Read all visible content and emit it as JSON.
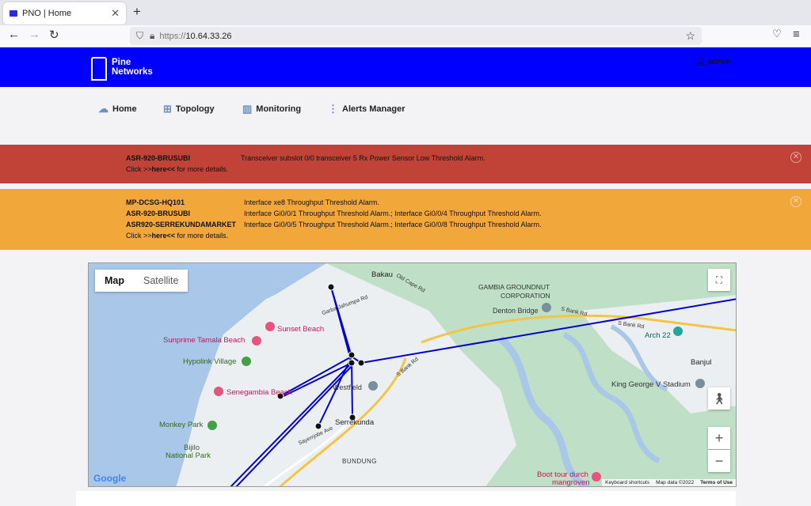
{
  "browser": {
    "tab_title": "PNO | Home",
    "url_protocol": "https://",
    "url_host": "10.64.33.26"
  },
  "header": {
    "logo_line1": "Pine",
    "logo_line2": "Networks",
    "user": "admin"
  },
  "menu": [
    {
      "label": "Home"
    },
    {
      "label": "Topology"
    },
    {
      "label": "Monitoring"
    },
    {
      "label": "Alerts Manager"
    }
  ],
  "alerts": {
    "red": {
      "device": "ASR-920-BRUSUBI",
      "message": "Transceiver subslot 0/0 transceiver 5 Rx Power Sensor Low Threshold Alarm.",
      "click_prefix": "Click >>",
      "click_link": "here<<",
      "click_suffix": " for more details."
    },
    "orange": {
      "rows": [
        {
          "device": "MP-DCSG-HQ101",
          "message": "Interface xe8 Throughput Threshold Alarm."
        },
        {
          "device": "ASR-920-BRUSUBI",
          "message": "Interface Gi0/0/1 Throughput Threshold Alarm.; Interface Gi0/0/4 Throughput Threshold Alarm."
        },
        {
          "device": "ASR920-SERREKUNDAMARKET",
          "message": "Interface Gi0/0/5 Throughput Threshold Alarm.; Interface Gi0/0/8 Throughput Threshold Alarm."
        }
      ],
      "click_prefix": "Click >>",
      "click_link": "here<<",
      "click_suffix": " for more details."
    }
  },
  "map": {
    "type_map": "Map",
    "type_satellite": "Satellite",
    "zoom_in": "+",
    "zoom_out": "−",
    "labels": {
      "bakau": "Bakau",
      "old_cape_rd": "Old Cape Rd",
      "gambia_groundnut": "GAMBIA GROUNDNUT",
      "corporation": "CORPORATION",
      "denton_bridge": "Denton Bridge",
      "s_bank_rd": "S Bank Rd",
      "arch22": "Arch 22",
      "banjul": "Banjul",
      "king_george": "King George V Stadium",
      "sunset_beach": "Sunset Beach",
      "sunprime": "Sunprime Tamala Beach",
      "hypolink": "Hypolink Village",
      "senegambia": "Senegambia Beach",
      "westfield": "Westfield",
      "serrekunda": "Serrekunda",
      "monkey_park": "Monkey Park",
      "bijilo": "Bijilo",
      "national_park": "National Park",
      "bundung": "BUNDUNG",
      "boot_tour": "Boot tour durch",
      "mangroven": "mangroven",
      "sayerr": "Sayerrjobe Ave",
      "jahumpa": "Garba Jahumpa Rd"
    },
    "attribution": {
      "shortcuts": "Keyboard shortcuts",
      "data": "Map data ©2022",
      "terms": "Terms of Use"
    },
    "google": "Google"
  }
}
